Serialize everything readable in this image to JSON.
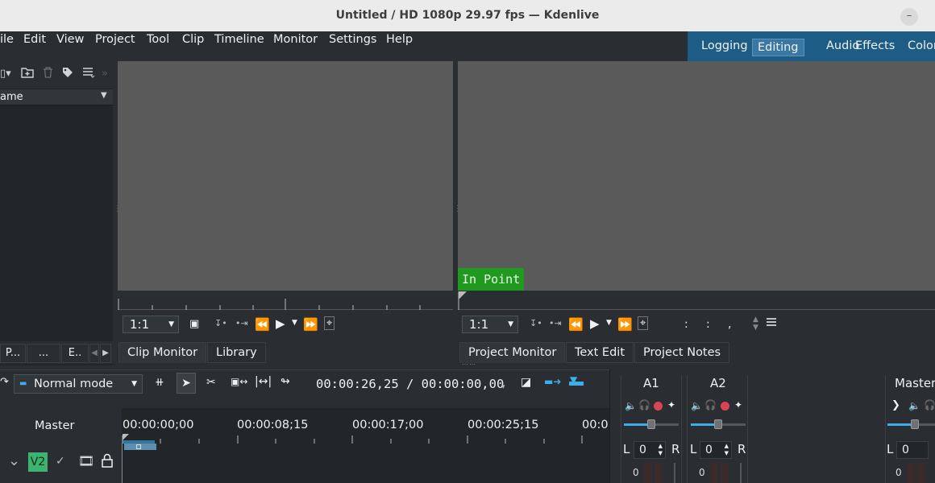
{
  "window": {
    "title": "Untitled / HD 1080p 29.97 fps — Kdenlive",
    "minimize_glyph": "–"
  },
  "menu": {
    "items": [
      {
        "label": "ile"
      },
      {
        "label": "Edit"
      },
      {
        "label": "View"
      },
      {
        "label": "Project"
      },
      {
        "label": "Tool"
      },
      {
        "label": "Clip"
      },
      {
        "label": "Timeline"
      },
      {
        "label": "Monitor"
      },
      {
        "label": "Settings"
      },
      {
        "label": "Help"
      }
    ]
  },
  "layouts": {
    "tabs": [
      {
        "label": "Logging"
      },
      {
        "label": "Editing"
      },
      {
        "label": "Audio"
      },
      {
        "label": "Effects"
      },
      {
        "label": "Color"
      }
    ],
    "active": "Editing"
  },
  "bin": {
    "column_header": "ame",
    "tabs": [
      {
        "label": "P..."
      },
      {
        "label": "..."
      },
      {
        "label": "E.."
      }
    ],
    "icons": [
      "add-clip-icon",
      "new-folder-icon",
      "delete-icon",
      "tag-icon",
      "menu-icon",
      "more-icon"
    ]
  },
  "clip_monitor": {
    "zoom": "1:1",
    "tabs": [
      {
        "label": "Clip Monitor"
      },
      {
        "label": "Library"
      }
    ]
  },
  "project_monitor": {
    "zoom": "1:1",
    "in_point_label": "In Point",
    "timecode_separators": [
      ":",
      ":",
      ","
    ],
    "tabs": [
      {
        "label": "Project Monitor"
      },
      {
        "label": "Text Edit"
      },
      {
        "label": "Project Notes"
      }
    ]
  },
  "timeline": {
    "mode": "Normal mode",
    "timecode": "00:00:26,25 / 00:00:00,00",
    "master_label": "Master",
    "ruler": [
      "00:00:00;00",
      "00:00:08;15",
      "00:00:17;00",
      "00:00:25;15",
      "00:0"
    ],
    "track": {
      "name": "V2"
    }
  },
  "mixer": {
    "strips": [
      {
        "name": "A1",
        "l": "L",
        "r": "R",
        "value": "0",
        "meter": "0"
      },
      {
        "name": "A2",
        "l": "L",
        "r": "R",
        "value": "0",
        "meter": "0"
      },
      {
        "name": "Master",
        "l": "L",
        "value": "0",
        "meter": "0"
      }
    ]
  },
  "colors": {
    "accent": "#3daee9",
    "layout_bar": "#1d5c84",
    "in_point": "#1f9a1f",
    "v2": "#3cb371",
    "record": "#da4453"
  }
}
